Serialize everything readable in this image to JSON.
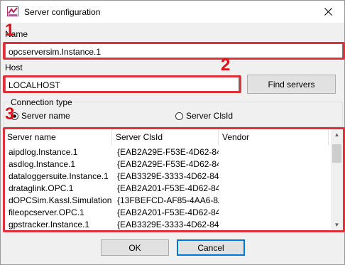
{
  "window": {
    "title": "Server configuration"
  },
  "markers": [
    "1",
    "2",
    "3"
  ],
  "name": {
    "label": "Name",
    "value": "opcserversim.Instance.1"
  },
  "host": {
    "label": "Host",
    "value": "LOCALHOST",
    "find_label": "Find servers"
  },
  "connection": {
    "label": "Connection type",
    "options": [
      {
        "label": "Server name",
        "selected": true
      },
      {
        "label": "Server ClsId",
        "selected": false
      }
    ]
  },
  "servers": {
    "columns": [
      "Server name",
      "Server ClsId",
      "Vendor"
    ],
    "rows": [
      [
        "aipdlog.Instance.1",
        "{EAB2A29E-F53E-4D62-84...",
        ""
      ],
      [
        "asdlog.Instance.1",
        "{EAB2A29E-F53E-4D62-84...",
        ""
      ],
      [
        "dataloggersuite.Instance.1",
        "{EAB3329E-3333-4D62-84...",
        ""
      ],
      [
        "drataglink.OPC.1",
        "{EAB2A201-F53E-4D62-84...",
        ""
      ],
      [
        "dOPCSim.Kassl.Simulation",
        "{13FBEFCD-AF85-4AA6-8A...",
        ""
      ],
      [
        "fileopcserver.OPC.1",
        "{EAB2A201-F53E-4D62-84...",
        ""
      ],
      [
        "gpstracker.Instance.1",
        "{EAB3329E-3333-4D62-84...",
        ""
      ]
    ]
  },
  "footer": {
    "ok_label": "OK",
    "cancel_label": "Cancel"
  },
  "colors": {
    "highlight_red": "#e0303a",
    "accent_blue": "#0078d7"
  },
  "icons": {
    "app": "app-logo-icon",
    "close": "close-icon"
  }
}
